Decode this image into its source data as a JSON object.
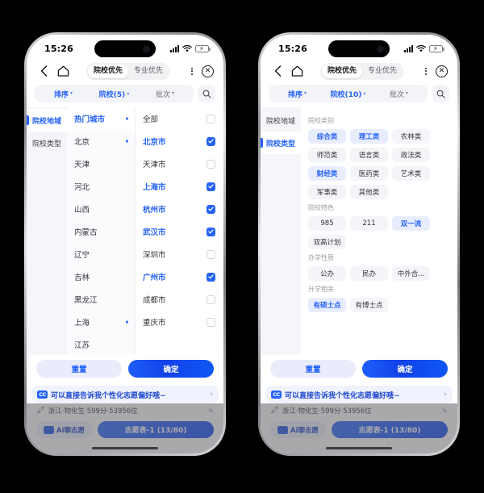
{
  "status_bar": {
    "time": "15:26",
    "battery_icon": "battery-charging-icon",
    "wifi_icon": "wifi-icon",
    "signal_icon": "signal-icon"
  },
  "nav": {
    "back_icon": "chevron-left-icon",
    "home_icon": "home-icon",
    "more_icon": "more-vertical-icon",
    "close_icon": "close-circle-icon",
    "segments": [
      {
        "label": "院校优先",
        "active": true
      },
      {
        "label": "专业优先",
        "active": false
      }
    ]
  },
  "filter_bar": {
    "left": {
      "label": "排序",
      "caret": "▾",
      "active": true
    },
    "center_left": {
      "label": "院校(5)",
      "caret": "▴",
      "active": true
    },
    "center_right": {
      "label": "院校(10)",
      "caret": "▴",
      "active": true
    },
    "right": {
      "label": "批次",
      "caret": "▾",
      "active": false
    },
    "search_icon": "search-icon"
  },
  "rail": {
    "items": [
      {
        "label": "院校地域"
      },
      {
        "label": "院校类型"
      }
    ]
  },
  "region_panel": {
    "provinces": [
      {
        "label": "热门城市",
        "active": true,
        "dot": true
      },
      {
        "label": "北京",
        "active": false,
        "dot": true
      },
      {
        "label": "天津",
        "active": false,
        "dot": false
      },
      {
        "label": "河北",
        "active": false,
        "dot": false
      },
      {
        "label": "山西",
        "active": false,
        "dot": false
      },
      {
        "label": "内蒙古",
        "active": false,
        "dot": false
      },
      {
        "label": "辽宁",
        "active": false,
        "dot": false
      },
      {
        "label": "吉林",
        "active": false,
        "dot": false
      },
      {
        "label": "黑龙江",
        "active": false,
        "dot": false
      },
      {
        "label": "上海",
        "active": false,
        "dot": true
      },
      {
        "label": "江苏",
        "active": false,
        "dot": false
      }
    ],
    "cities": [
      {
        "label": "全部",
        "checked": false
      },
      {
        "label": "北京市",
        "checked": true
      },
      {
        "label": "天津市",
        "checked": false
      },
      {
        "label": "上海市",
        "checked": true
      },
      {
        "label": "杭州市",
        "checked": true
      },
      {
        "label": "武汉市",
        "checked": true
      },
      {
        "label": "深圳市",
        "checked": false
      },
      {
        "label": "广州市",
        "checked": true
      },
      {
        "label": "成都市",
        "checked": false
      },
      {
        "label": "重庆市",
        "checked": false
      }
    ]
  },
  "type_panel": {
    "groups": [
      {
        "title": "院校类别",
        "tags": [
          {
            "label": "综合类",
            "selected": true
          },
          {
            "label": "理工类",
            "selected": true
          },
          {
            "label": "农林类",
            "selected": false
          },
          {
            "label": "师范类",
            "selected": false
          },
          {
            "label": "语言类",
            "selected": false
          },
          {
            "label": "政法类",
            "selected": false
          },
          {
            "label": "财经类",
            "selected": true
          },
          {
            "label": "医药类",
            "selected": false
          },
          {
            "label": "艺术类",
            "selected": false
          },
          {
            "label": "军事类",
            "selected": false
          },
          {
            "label": "其他类",
            "selected": false
          }
        ]
      },
      {
        "title": "院校特色",
        "tags": [
          {
            "label": "985",
            "selected": false
          },
          {
            "label": "211",
            "selected": false
          },
          {
            "label": "双一流",
            "selected": true
          },
          {
            "label": "双高计划",
            "selected": false
          }
        ]
      },
      {
        "title": "办学性质",
        "tags": [
          {
            "label": "公办",
            "selected": false
          },
          {
            "label": "民办",
            "selected": false
          },
          {
            "label": "中外合...",
            "selected": false
          }
        ]
      },
      {
        "title": "升学相关",
        "tags": [
          {
            "label": "有硕士点",
            "selected": true
          },
          {
            "label": "有博士点",
            "selected": false
          }
        ]
      }
    ]
  },
  "panel_actions": {
    "reset_label": "重置",
    "confirm_label": "确定"
  },
  "ai_banner": {
    "badge": "CC",
    "text": "可以直接告诉我个性化志愿偏好哦~",
    "arrow": "›"
  },
  "bottom": {
    "score_icon": "pencil-marker-icon",
    "score_text": "浙江·物化生·599分·53956位",
    "edit_icon": "edit-pencil-icon",
    "ai_chat_badge": "CC",
    "ai_chat_label": "Ai聊志愿",
    "wish_label": "志愿表-1 (13/80)"
  },
  "colors": {
    "accent": "#2563f5",
    "accent_dark": "#1142e8",
    "chip_selected_bg": "#e8edfe",
    "chip_bg": "#f4f5f8",
    "rail_bg": "#f5f6fa",
    "battery_green": "#32d74b"
  }
}
